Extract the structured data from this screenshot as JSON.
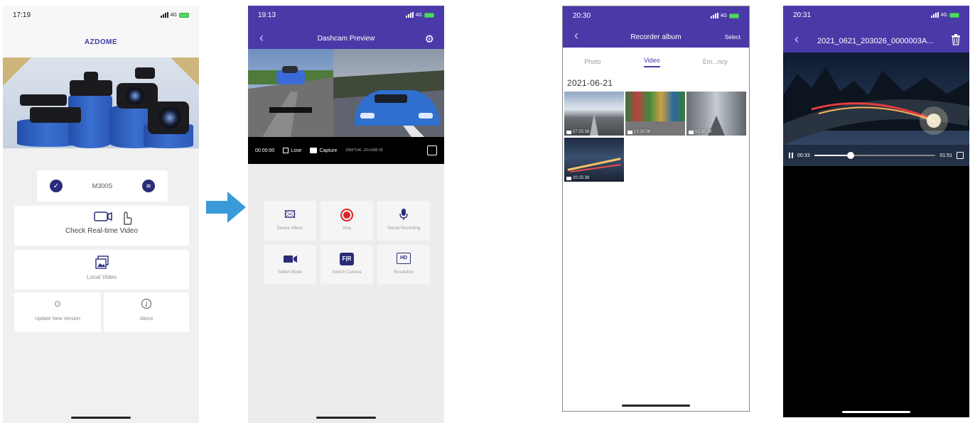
{
  "phone1": {
    "status_time": "17:19",
    "network": "4G",
    "brand": "AZDOME",
    "device_name": "M300S",
    "realtime_label": "Check Real-time Video",
    "local_label": "Local Video",
    "update_label": "Update New Version",
    "about_label": "About"
  },
  "phone2": {
    "status_time": "19:13",
    "network": "4G",
    "title": "Dashcam Preview",
    "controls": {
      "time": "00:00:00",
      "lose": "Lose",
      "capture": "Capture",
      "resolution": "2560*144...20+1080 30"
    },
    "buttons": [
      {
        "label": "Device Album"
      },
      {
        "label": "Stop"
      },
      {
        "label": "Sound Recording"
      },
      {
        "label": "Switch Mode"
      },
      {
        "label": "Switch Camera"
      },
      {
        "label": "Resolution"
      }
    ]
  },
  "phone3": {
    "status_time": "20:30",
    "network": "4G",
    "title": "Recorder album",
    "select_label": "Select",
    "tabs": [
      "Photo",
      "Video",
      "Em...ncy"
    ],
    "active_tab": "Video",
    "date": "2021-06-21",
    "videos": [
      {
        "time": "07:25:38"
      },
      {
        "time": "12:30:06"
      },
      {
        "time": "15:30:38"
      },
      {
        "time": "20:25:38"
      }
    ]
  },
  "phone4": {
    "status_time": "20:31",
    "network": "4G",
    "title": "2021_0621_203026_0000003A...",
    "elapsed": "00:33",
    "duration": "01:51",
    "progress": 0.3
  },
  "colors": {
    "header_purple": "#4a3aa8",
    "accent_navy": "#2a2c7a",
    "record_red": "#e02424",
    "arrow_blue": "#3a9ad9"
  }
}
